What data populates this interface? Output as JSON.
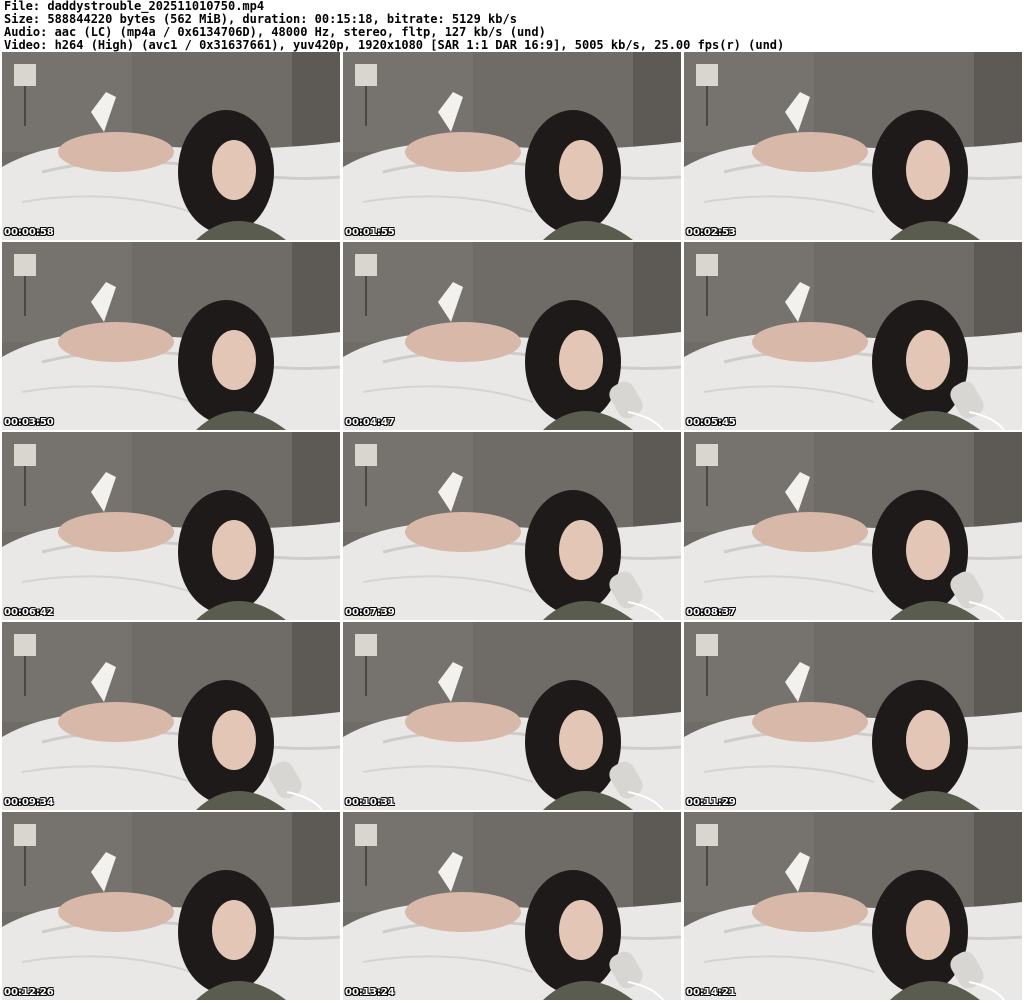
{
  "header": {
    "file_line": "File: daddystrouble_202511010750.mp4",
    "size_line": "Size: 588844220 bytes (562 MiB), duration: 00:15:18, bitrate: 5129 kb/s",
    "audio_line": "Audio: aac (LC) (mp4a / 0x6134706D), 48000 Hz, stereo, fltp, 127 kb/s (und)",
    "video_line": "Video: h264 (High) (avc1 / 0x31637661), yuv420p, 1920x1080 [SAR 1:1 DAR 16:9], 5005 kb/s, 25.00 fps(r) (und)"
  },
  "thumbnails": [
    {
      "timestamp": "00:00:58",
      "has_mic": false
    },
    {
      "timestamp": "00:01:55",
      "has_mic": false
    },
    {
      "timestamp": "00:02:53",
      "has_mic": false
    },
    {
      "timestamp": "00:03:50",
      "has_mic": false
    },
    {
      "timestamp": "00:04:47",
      "has_mic": true
    },
    {
      "timestamp": "00:05:45",
      "has_mic": true
    },
    {
      "timestamp": "00:06:42",
      "has_mic": false
    },
    {
      "timestamp": "00:07:39",
      "has_mic": true
    },
    {
      "timestamp": "00:08:37",
      "has_mic": true
    },
    {
      "timestamp": "00:09:34",
      "has_mic": true
    },
    {
      "timestamp": "00:10:31",
      "has_mic": true
    },
    {
      "timestamp": "00:11:29",
      "has_mic": false
    },
    {
      "timestamp": "00:12:26",
      "has_mic": false
    },
    {
      "timestamp": "00:13:24",
      "has_mic": true
    },
    {
      "timestamp": "00:14:21",
      "has_mic": true
    }
  ],
  "colors": {
    "background": "#ffffff",
    "text": "#000000",
    "timestamp": "#ffffff",
    "wall": "#6f6b66",
    "sheets": "#e9e8e6"
  }
}
